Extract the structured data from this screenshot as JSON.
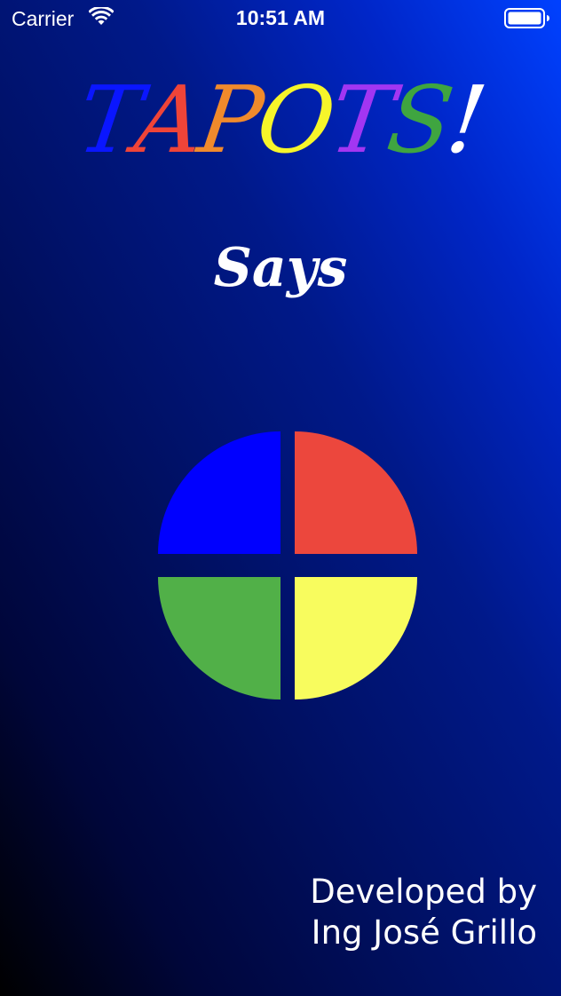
{
  "status_bar": {
    "carrier": "Carrier",
    "time": "10:51 AM",
    "icons": [
      "wifi-icon",
      "battery-icon"
    ]
  },
  "title": {
    "letters": [
      {
        "char": "T",
        "color": "#0a16ff"
      },
      {
        "char": "A",
        "color": "#ef4438"
      },
      {
        "char": "P",
        "color": "#f08a2c"
      },
      {
        "char": "O",
        "color": "#f6f52a"
      },
      {
        "char": "T",
        "color": "#a236f2"
      },
      {
        "char": "S",
        "color": "#3fa540"
      },
      {
        "char": "!",
        "color": "#ffffff"
      }
    ]
  },
  "subtitle": "Says",
  "pads": {
    "blue": "#0000ff",
    "red": "#ec473d",
    "green": "#51b048",
    "yellow": "#f8fc5e"
  },
  "credits": {
    "line1": "Developed by",
    "line2": "Ing José Grillo"
  }
}
